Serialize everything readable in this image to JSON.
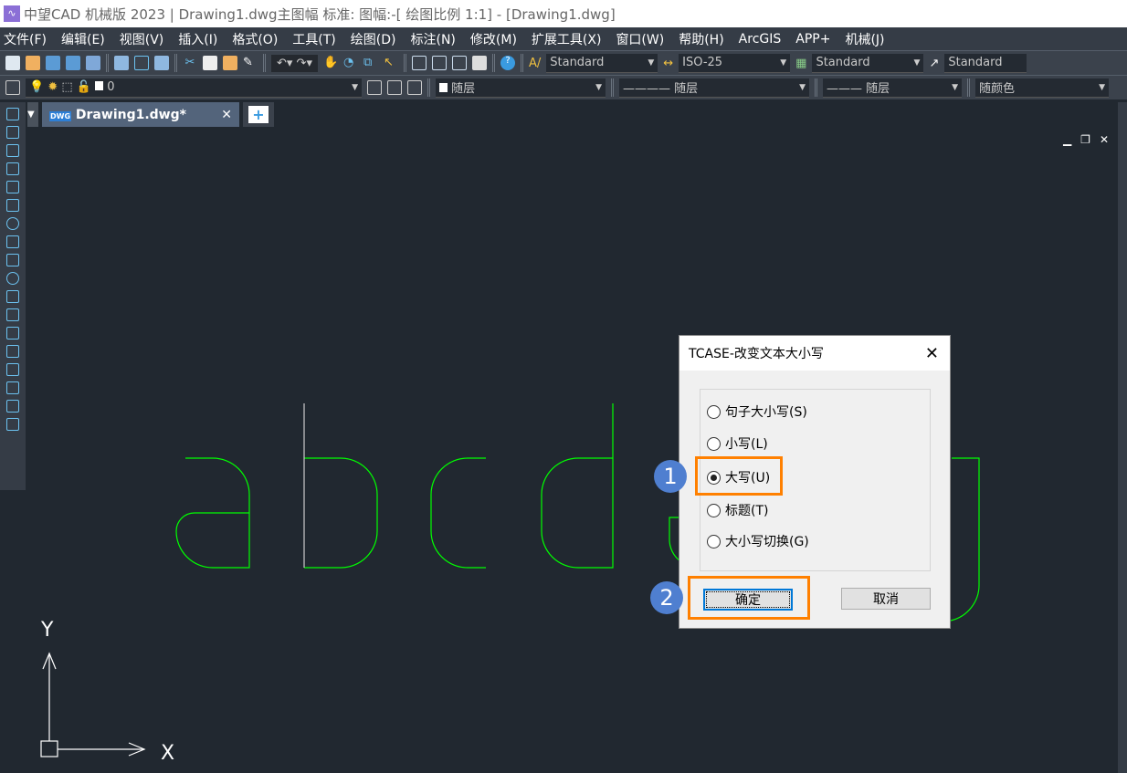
{
  "title": "中望CAD 机械版 2023 | Drawing1.dwg主图幅  标准: 图幅:-[ 绘图比例 1:1] - [Drawing1.dwg]",
  "menu": [
    "文件(F)",
    "编辑(E)",
    "视图(V)",
    "插入(I)",
    "格式(O)",
    "工具(T)",
    "绘图(D)",
    "标注(N)",
    "修改(M)",
    "扩展工具(X)",
    "窗口(W)",
    "帮助(H)",
    "ArcGIS",
    "APP+",
    "机械(J)"
  ],
  "styles": {
    "text_style": "Standard",
    "dim_style": "ISO-25",
    "table_style": "Standard",
    "mleader_style": "Standard"
  },
  "layer": {
    "current": "0",
    "color": "随层",
    "linetype": "随层",
    "lineweight": "随层",
    "plotstyle": "随颜色"
  },
  "tab": {
    "label": "Drawing1.dwg*"
  },
  "canvas": {
    "y_label": "Y",
    "x_label": "X",
    "stroke": "#00ff00"
  },
  "dialog": {
    "title": "TCASE-改变文本大小写",
    "options": [
      "句子大小写(S)",
      "小写(L)",
      "大写(U)",
      "标题(T)",
      "大小写切换(G)"
    ],
    "selected": "大写(U)",
    "ok": "确定",
    "cancel": "取消"
  },
  "annotations": {
    "step1": "1",
    "step2": "2",
    "highlight_color": "#ff8000"
  }
}
